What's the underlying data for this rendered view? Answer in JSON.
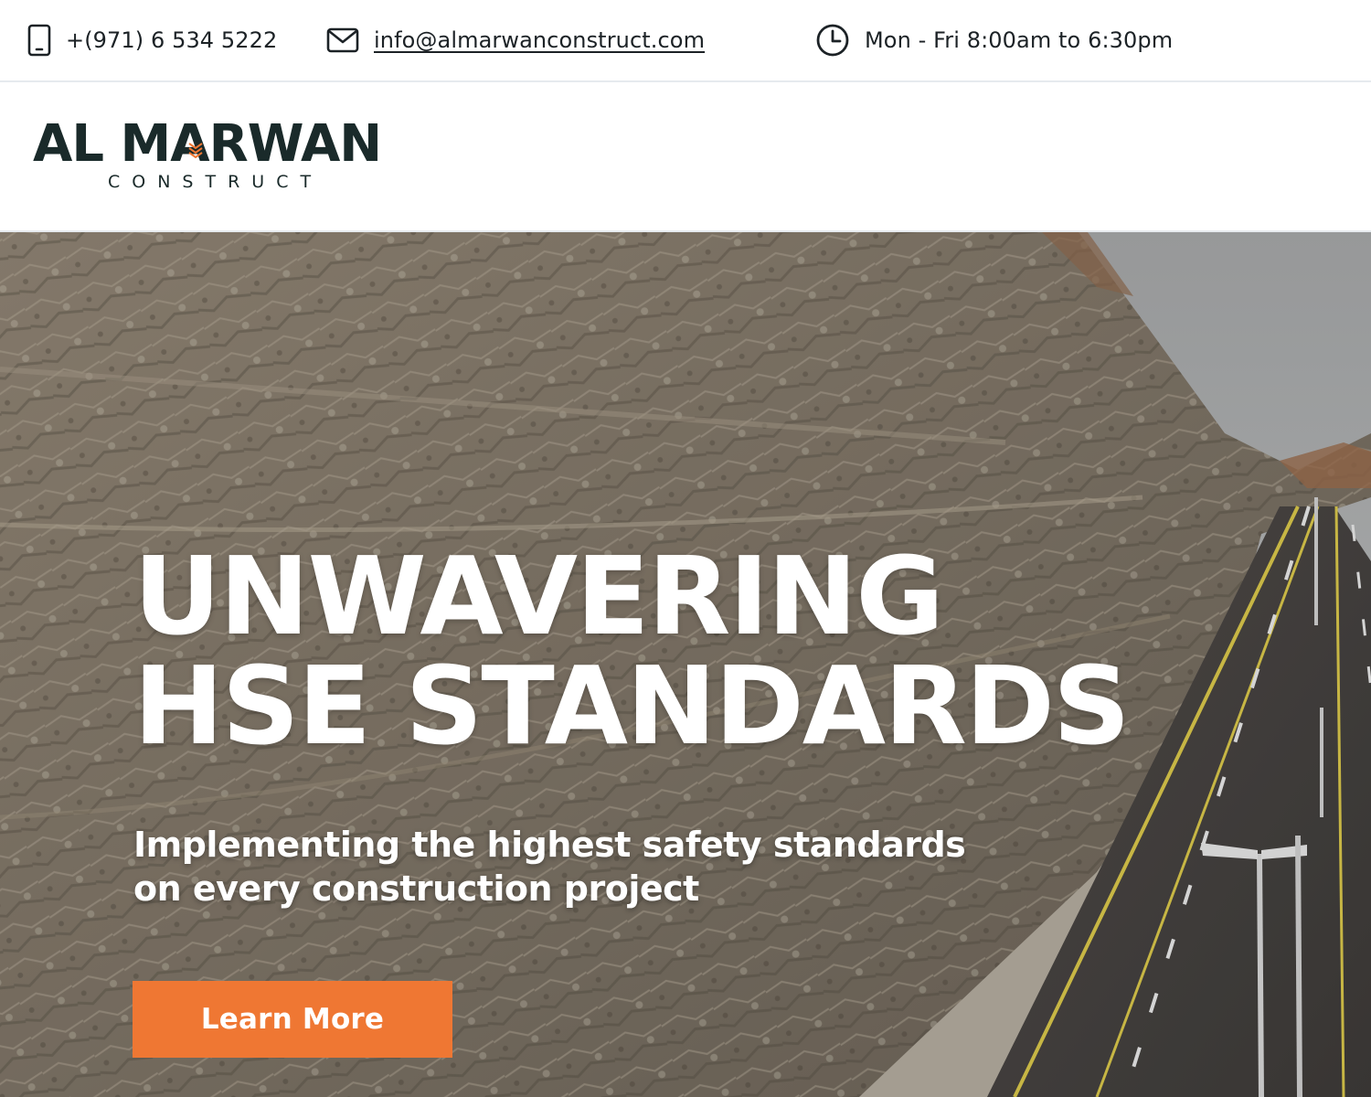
{
  "topbar": {
    "phone": {
      "icon": "phone-icon",
      "text": "+(971) 6 534 5222"
    },
    "email": {
      "icon": "mail-icon",
      "text": "info@almarwanconstruct.com"
    },
    "hours": {
      "icon": "clock-icon",
      "text": "Mon - Fri 8:00am to 6:30pm"
    }
  },
  "header": {
    "logo": {
      "main": "AL MARWAN",
      "sub": "CONSTRUCT"
    }
  },
  "hero": {
    "title_line1": "UNWAVERING",
    "title_line2": "HSE STANDARDS",
    "subtitle_line1": "Implementing the highest safety standards",
    "subtitle_line2": "on every construction project",
    "cta_label": "Learn More"
  },
  "colors": {
    "accent": "#ef7733",
    "logo_dark": "#1a2a2a",
    "text": "#1c2226"
  }
}
